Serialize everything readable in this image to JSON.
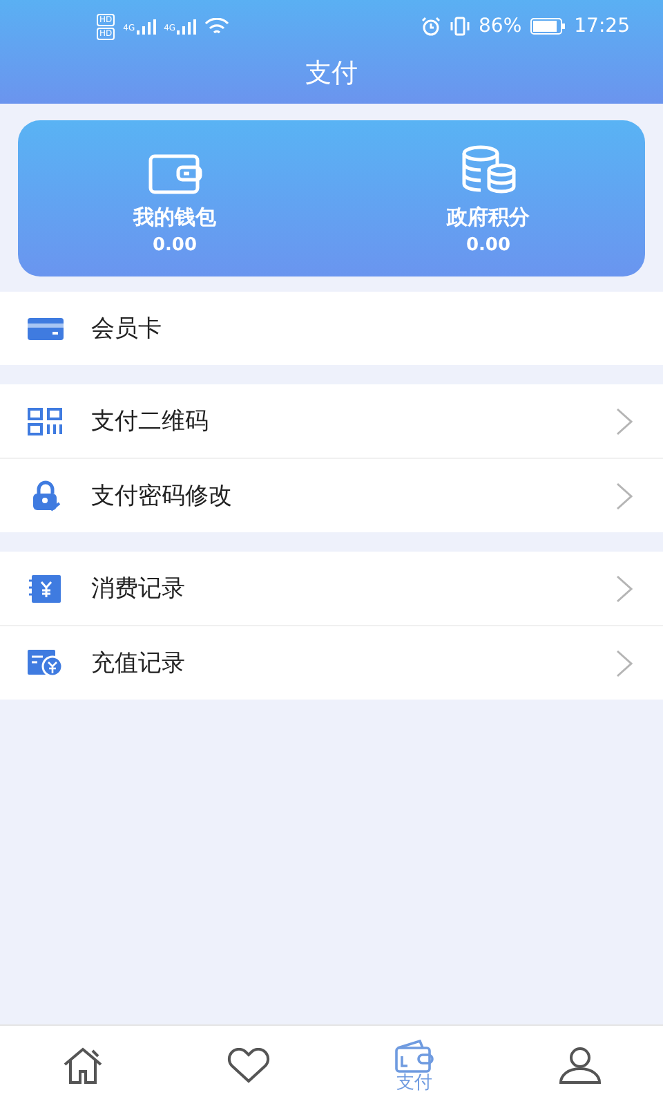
{
  "status_bar": {
    "sim_labels": [
      "HD",
      "HD"
    ],
    "network_labels": [
      "4G",
      "4G"
    ],
    "battery": "86%",
    "time": "17:25"
  },
  "header": {
    "title": "支付"
  },
  "balances": [
    {
      "kind": "wallet",
      "label": "我的钱包",
      "value": "0.00"
    },
    {
      "kind": "coins",
      "label": "政府积分",
      "value": "0.00"
    }
  ],
  "menu_groups": [
    [
      {
        "kind": "card",
        "label": "会员卡",
        "chevron": false
      }
    ],
    [
      {
        "kind": "qr",
        "label": "支付二维码",
        "chevron": true
      },
      {
        "kind": "lock",
        "label": "支付密码修改",
        "chevron": true
      }
    ],
    [
      {
        "kind": "bill",
        "label": "消费记录",
        "chevron": true
      },
      {
        "kind": "recharge",
        "label": "充值记录",
        "chevron": true
      }
    ]
  ],
  "tab_bar": [
    {
      "kind": "home",
      "selected": false
    },
    {
      "kind": "heart",
      "selected": false
    },
    {
      "kind": "wallet",
      "label": "支付",
      "selected": true
    },
    {
      "kind": "person",
      "selected": false
    }
  ]
}
